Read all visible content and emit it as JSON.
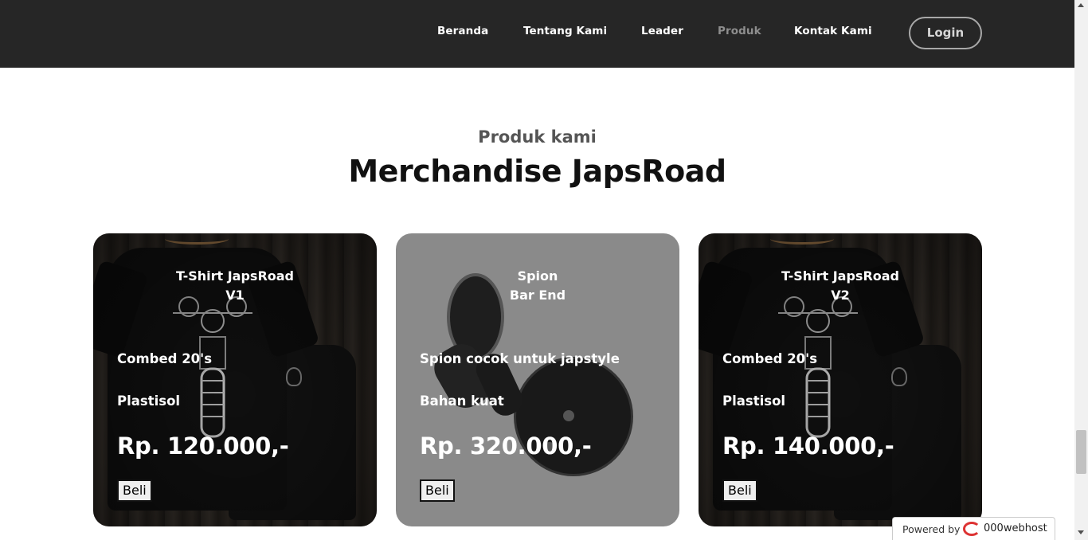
{
  "nav": {
    "links": [
      "Beranda",
      "Tentang Kami",
      "Leader",
      "Produk",
      "Kontak Kami"
    ],
    "active": "Produk",
    "login": "Login"
  },
  "section": {
    "subtitle": "Produk kami",
    "title": "Merchandise JapsRoad"
  },
  "products": [
    {
      "title_line1": "T-Shirt JapsRoad",
      "title_line2": "V1",
      "feature1": "Combed 20's",
      "feature2": "Plastisol",
      "price": "Rp. 120.000,-",
      "buy": "Beli"
    },
    {
      "title_line1": "Spion",
      "title_line2": "Bar End",
      "feature1": "Spion cocok untuk japstyle",
      "feature2": "Bahan kuat",
      "price": "Rp. 320.000,-",
      "buy": "Beli"
    },
    {
      "title_line1": "T-Shirt JapsRoad",
      "title_line2": "V2",
      "feature1": "Combed 20's",
      "feature2": "Plastisol",
      "price": "Rp. 140.000,-",
      "buy": "Beli"
    }
  ],
  "badge": {
    "prefix": "Powered by",
    "brand": "000webhost"
  },
  "colors": {
    "navbar": "#262626",
    "active_link": "#8e8e8e",
    "card_grey": "#8a8a8a"
  }
}
